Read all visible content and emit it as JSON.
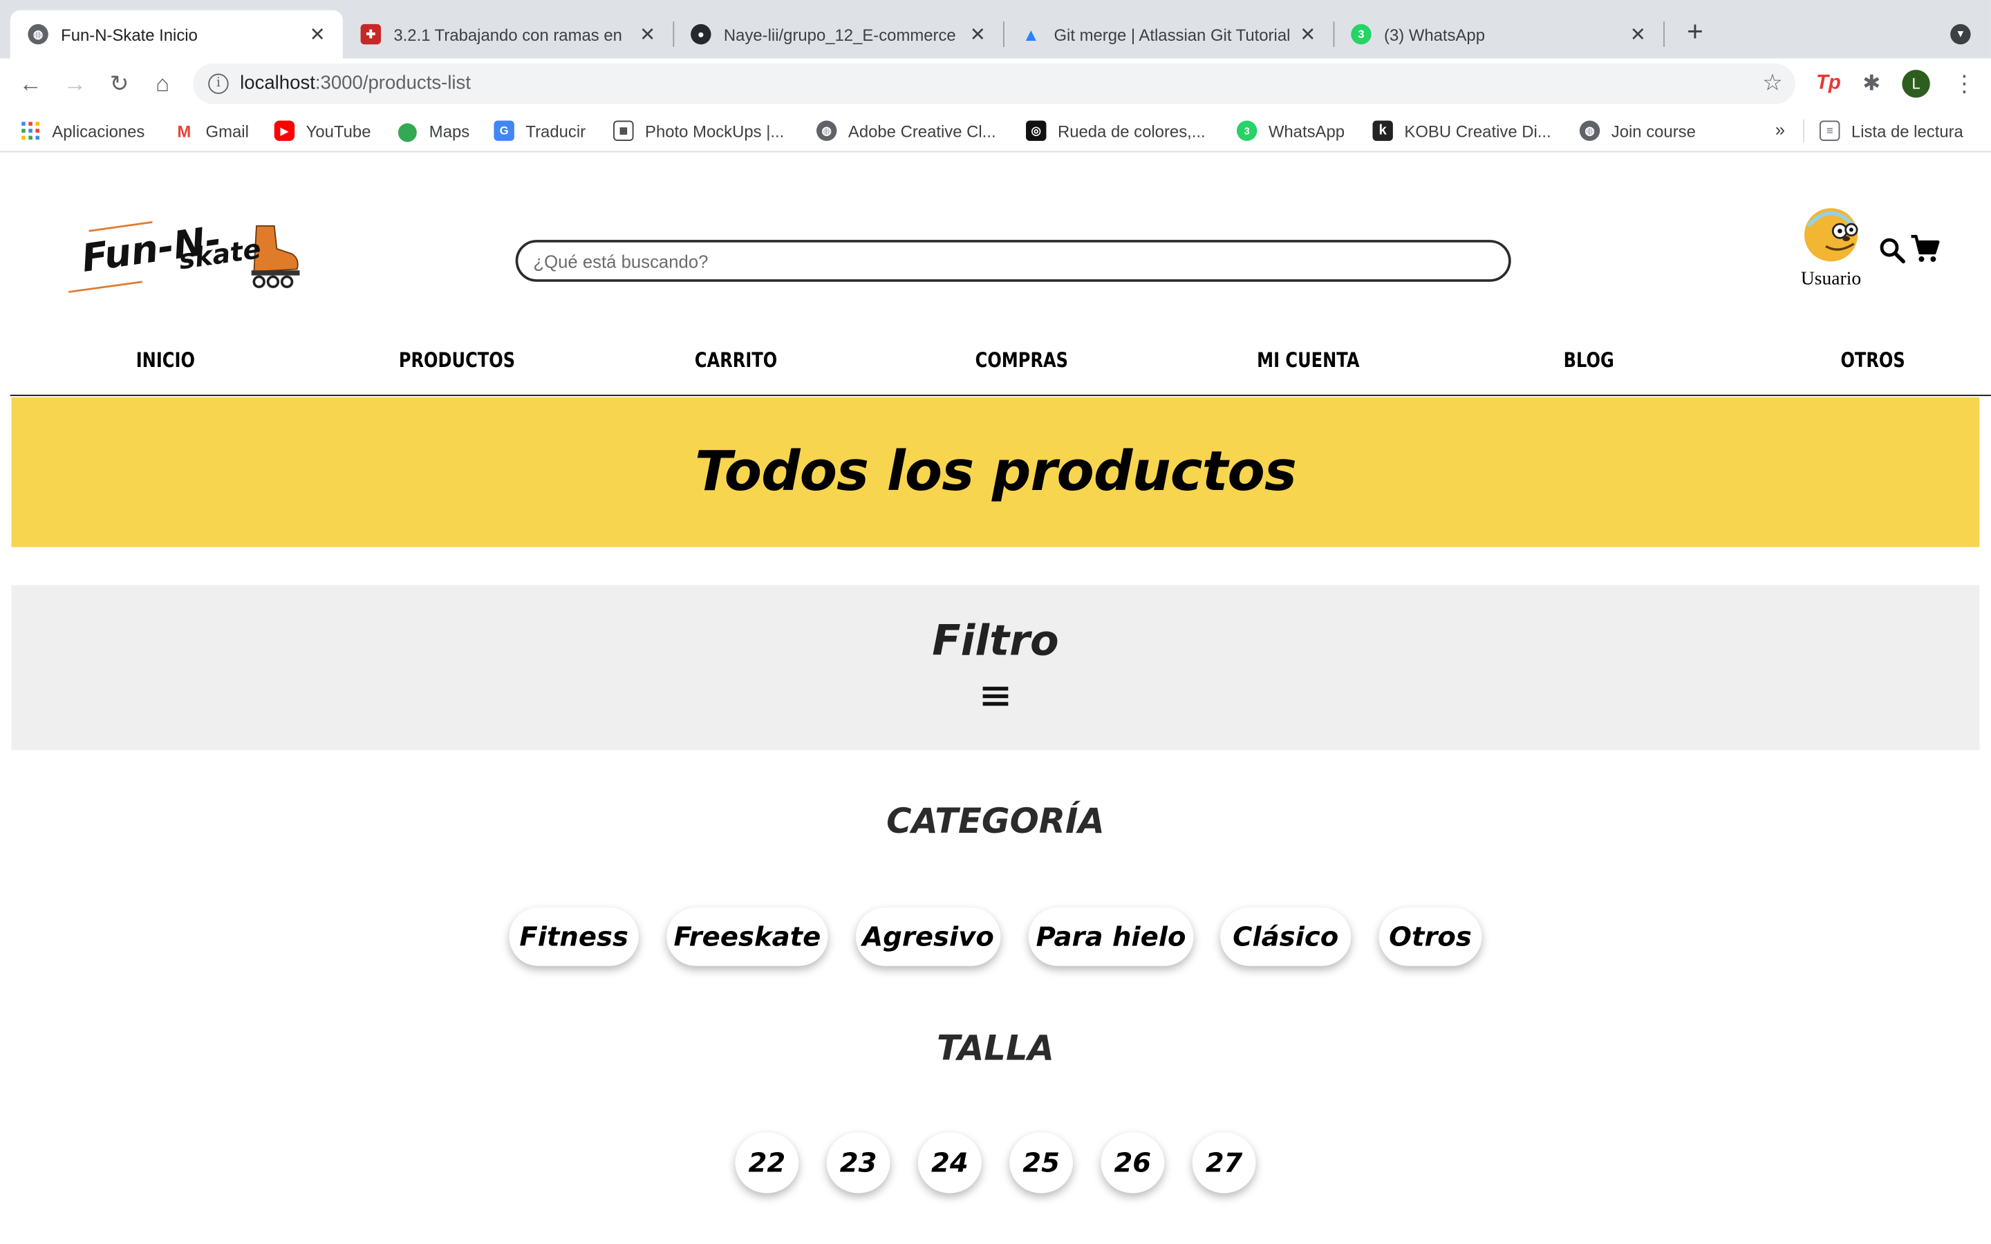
{
  "browser": {
    "tabs": [
      {
        "title": "Fun-N-Skate Inicio",
        "favicon": "globe-icon",
        "color": "#5f6368"
      },
      {
        "title": "3.2.1 Trabajando con ramas en",
        "favicon": "puzzle-favicon",
        "color": "#c62828"
      },
      {
        "title": "Naye-lii/grupo_12_E-commerce",
        "favicon": "github-icon",
        "color": "#24292e"
      },
      {
        "title": "Git merge | Atlassian Git Tutorial",
        "favicon": "atlassian-icon",
        "color": "#2684ff"
      },
      {
        "title": "(3) WhatsApp",
        "favicon": "whatsapp-icon",
        "color": "#25d366",
        "badge": "3"
      }
    ],
    "url_host": "localhost",
    "url_path": ":3000/products-list",
    "profile_initial": "L",
    "extension_label": "Tp",
    "bookmarks": [
      {
        "label": "Aplicaciones",
        "icon": "apps-grid-icon",
        "color": "#4285f4"
      },
      {
        "label": "Gmail",
        "icon": "gmail-icon",
        "color": "#ea4335"
      },
      {
        "label": "YouTube",
        "icon": "youtube-icon",
        "color": "#ff0000"
      },
      {
        "label": "Maps",
        "icon": "maps-pin-icon",
        "color": "#34a853"
      },
      {
        "label": "Traducir",
        "icon": "translate-icon",
        "color": "#4285f4"
      },
      {
        "label": "Photo MockUps |...",
        "icon": "mockup-icon",
        "color": "#3c4043"
      },
      {
        "label": "Adobe Creative Cl...",
        "icon": "globe-icon",
        "color": "#5f6368"
      },
      {
        "label": "Rueda de colores,...",
        "icon": "color-wheel-icon",
        "color": "#111111"
      },
      {
        "label": "WhatsApp",
        "icon": "whatsapp-icon",
        "color": "#25d366"
      },
      {
        "label": "KOBU Creative Di...",
        "icon": "kobu-icon",
        "color": "#222222"
      },
      {
        "label": "Join course",
        "icon": "globe-icon",
        "color": "#5f6368"
      }
    ],
    "more_bookmarks": "»",
    "reading_list": "Lista de lectura"
  },
  "site": {
    "logo_text_a": "Fun-N-",
    "logo_text_b": "skate",
    "search_placeholder": "¿Qué está buscando?",
    "user_label": "Usuario",
    "nav": [
      "INICIO",
      "PRODUCTOS",
      "CARRITO",
      "COMPRAS",
      "MI CUENTA",
      "BLOG",
      "OTROS"
    ],
    "banner_title": "Todos los productos",
    "filter_title": "Filtro",
    "category_title": "CATEGORÍA",
    "categories": [
      "Fitness",
      "Freeskate",
      "Agresivo",
      "Para hielo",
      "Clásico",
      "Otros"
    ],
    "size_title": "TALLA",
    "sizes": [
      "22",
      "23",
      "24",
      "25",
      "26",
      "27"
    ],
    "colors": {
      "banner": "#f8d54f",
      "filter_bg": "#efefef",
      "logo_orange": "#e07b2a"
    }
  }
}
